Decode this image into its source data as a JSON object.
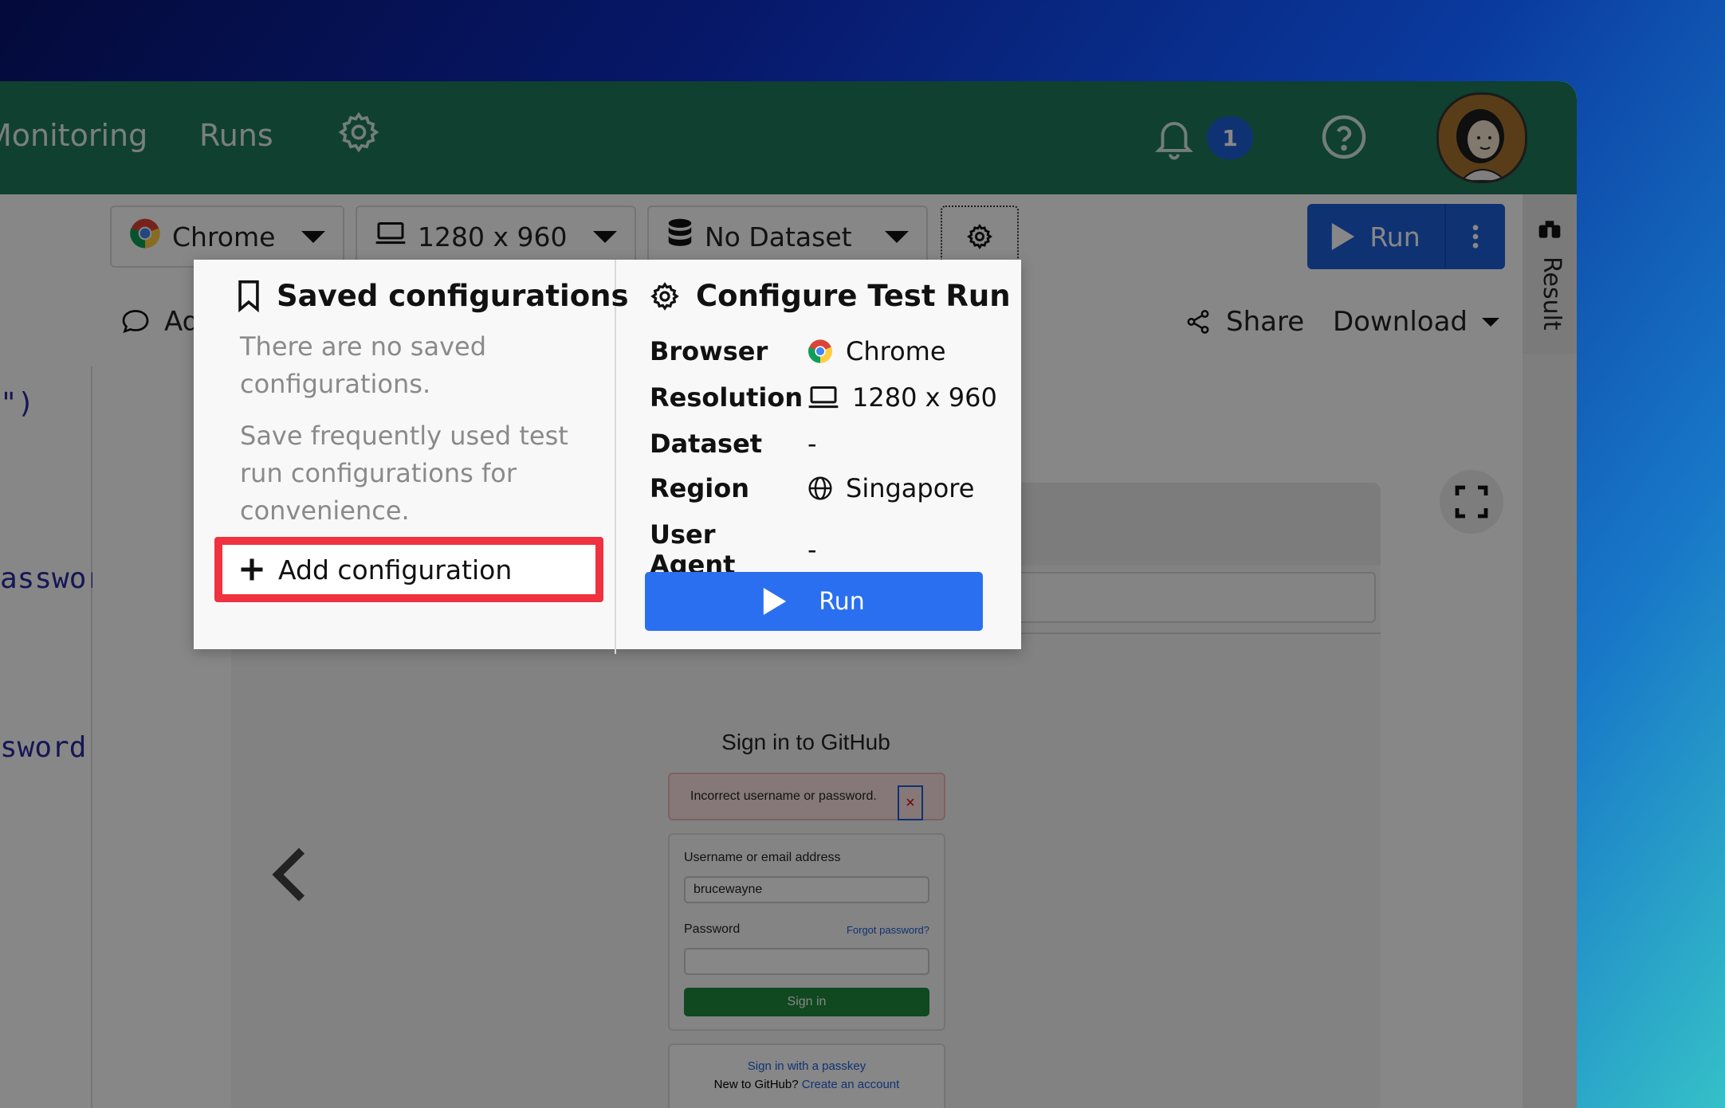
{
  "nav": {
    "links": [
      "Monitoring",
      "Runs"
    ],
    "notification_count": "1"
  },
  "toolbar": {
    "browser": "Chrome",
    "resolution": "1280 x 960",
    "dataset": "No Dataset",
    "run_label": "Run"
  },
  "subbar": {
    "add_comment": "Add",
    "share": "Share",
    "download": "Download"
  },
  "code_lines": [
    "\")",
    "asswor",
    "sword'"
  ],
  "result_tab": "Result",
  "preview": {
    "title": "Sign in to GitHub",
    "error": "Incorrect username or password.",
    "error_close": "×",
    "username_label": "Username or email address",
    "username_value": "brucewayne",
    "password_label": "Password",
    "forgot": "Forgot password?",
    "signin_button": "Sign in",
    "passkey": "Sign in with a passkey",
    "new_to": "New to GitHub?",
    "create_account": "Create an account"
  },
  "popover": {
    "saved_title": "Saved configurations",
    "empty_text": "There are no saved configurations.",
    "hint_text": "Save frequently used test run configurations for convenience.",
    "add_button": "Add configuration",
    "config_title": "Configure Test Run",
    "rows": [
      {
        "key": "Browser",
        "value": "Chrome"
      },
      {
        "key": "Resolution",
        "value": "1280 x 960"
      },
      {
        "key": "Dataset",
        "value": "-"
      },
      {
        "key": "Region",
        "value": "Singapore"
      },
      {
        "key": "User Agent",
        "value": "-"
      }
    ],
    "run_button": "Run"
  },
  "colors": {
    "nav_green": "#1f7a5c",
    "primary_blue": "#1e5fd9",
    "highlight_red": "#f0313f"
  }
}
